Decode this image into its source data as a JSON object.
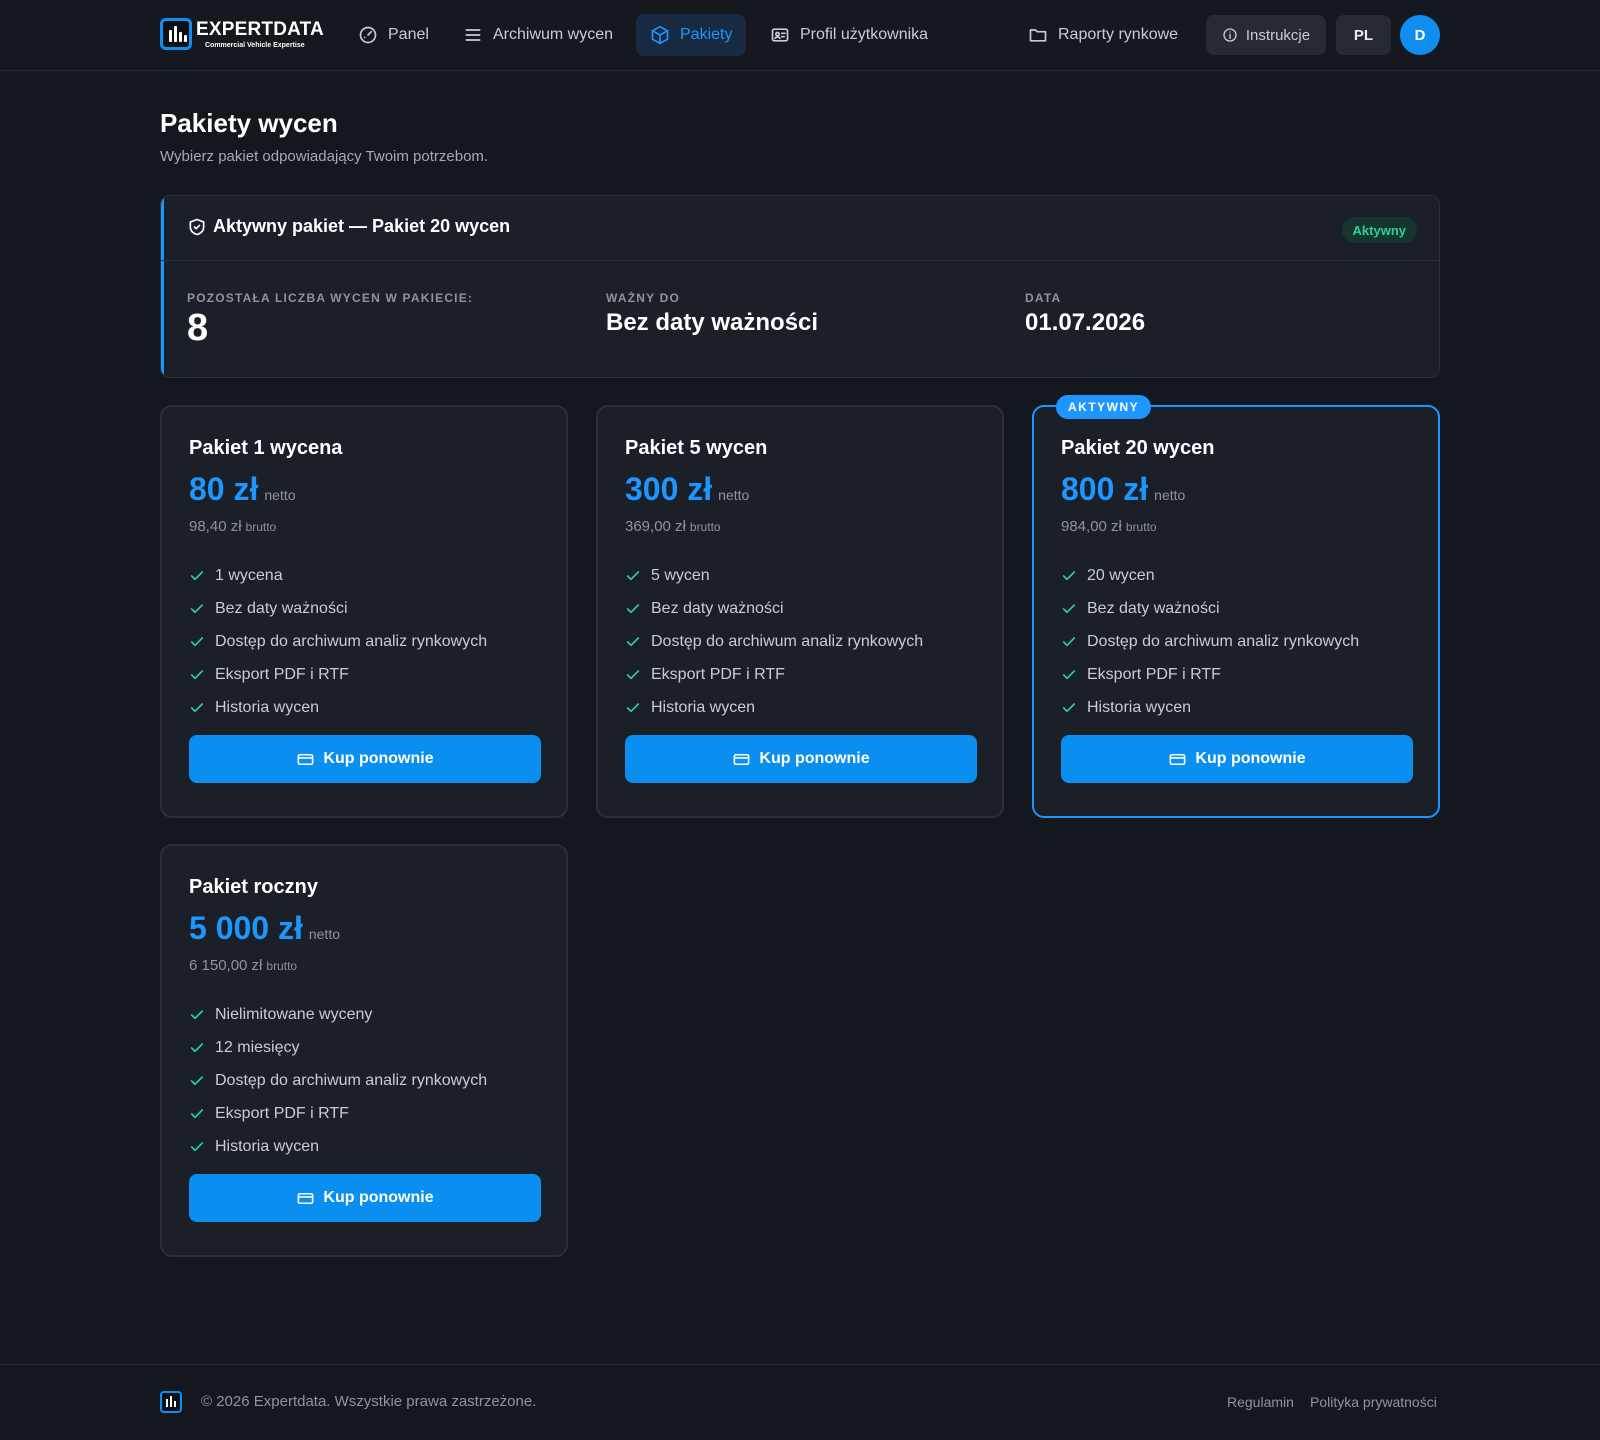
{
  "brand": {
    "name": "EXPERTDATA",
    "tagline": "Commercial Vehicle Expertise"
  },
  "nav": {
    "items": [
      {
        "label": "Panel",
        "icon": "gauge-icon"
      },
      {
        "label": "Archiwum wycen",
        "icon": "list-icon"
      },
      {
        "label": "Pakiety",
        "icon": "package-icon",
        "active": true
      },
      {
        "label": "Profil użytkownika",
        "icon": "id-card-icon"
      }
    ],
    "reports": "Raporty rynkowe",
    "instructions": "Instrukcje",
    "language": "PL",
    "avatar_initial": "D"
  },
  "page": {
    "title": "Pakiety wycen",
    "subtitle": "Wybierz pakiet odpowiadający Twoim potrzebom."
  },
  "active_package": {
    "title": "Aktywny pakiet — Pakiet 20 wycen",
    "status": "Aktywny",
    "remaining_label": "POZOSTAŁA LICZBA WYCEN W PAKIECIE:",
    "remaining_value": "8",
    "valid_label": "WAŻNY DO",
    "valid_value": "Bez daty ważności",
    "date_label": "DATA",
    "date_value": "01.07.2026"
  },
  "packages": [
    {
      "name": "Pakiet 1 wycena",
      "price": "80 zł",
      "net_label": "netto",
      "gross": "98,40 zł",
      "gross_label": "brutto",
      "features": [
        "1 wycena",
        "Bez daty ważności",
        "Dostęp do archiwum analiz rynkowych",
        "Eksport PDF i RTF",
        "Historia wycen"
      ],
      "button": "Kup ponownie"
    },
    {
      "name": "Pakiet 5 wycen",
      "price": "300 zł",
      "net_label": "netto",
      "gross": "369,00 zł",
      "gross_label": "brutto",
      "features": [
        "5 wycen",
        "Bez daty ważności",
        "Dostęp do archiwum analiz rynkowych",
        "Eksport PDF i RTF",
        "Historia wycen"
      ],
      "button": "Kup ponownie"
    },
    {
      "name": "Pakiet 20 wycen",
      "ribbon": "AKTYWNY",
      "price": "800 zł",
      "net_label": "netto",
      "gross": "984,00 zł",
      "gross_label": "brutto",
      "features": [
        "20 wycen",
        "Bez daty ważności",
        "Dostęp do archiwum analiz rynkowych",
        "Eksport PDF i RTF",
        "Historia wycen"
      ],
      "button": "Kup ponownie"
    },
    {
      "name": "Pakiet roczny",
      "price": "5 000 zł",
      "net_label": "netto",
      "gross": "6 150,00 zł",
      "gross_label": "brutto",
      "features": [
        "Nielimitowane wyceny",
        "12 miesięcy",
        "Dostęp do archiwum analiz rynkowych",
        "Eksport PDF i RTF",
        "Historia wycen"
      ],
      "button": "Kup ponownie"
    }
  ],
  "footer": {
    "copyright": "© 2026 Expertdata. Wszystkie prawa zastrzeżone.",
    "links": [
      "Regulamin",
      "Polityka prywatności"
    ]
  },
  "colors": {
    "accent": "#1d97ff",
    "success": "#2fcf99",
    "background": "#14171e",
    "card": "#1b1f27"
  }
}
